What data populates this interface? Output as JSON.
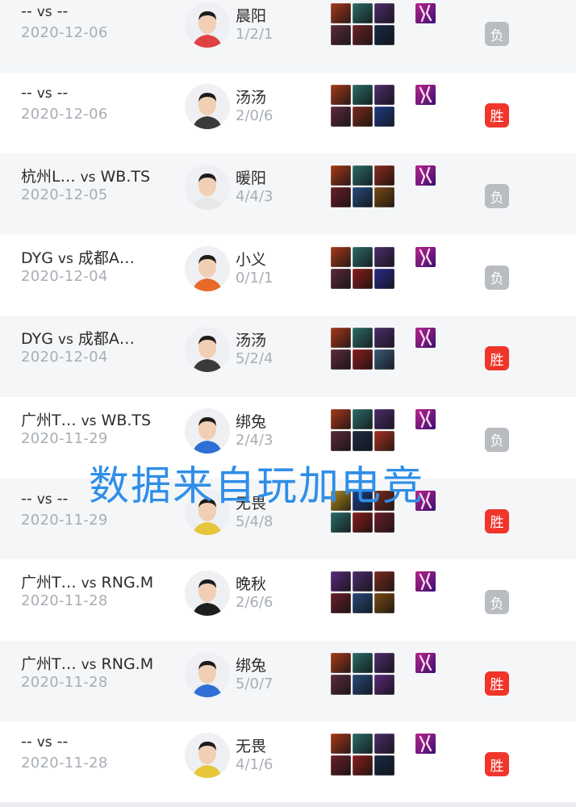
{
  "colors": {
    "win_badge": "#f0352b",
    "loss_badge": "#b9bcc1",
    "watermark": "#2f8ee8",
    "date_text": "#a8aeb5"
  },
  "matches": [
    {
      "team1": "--",
      "vs": "vs",
      "team2": "--",
      "date": "2020-12-06",
      "player": "晨阳",
      "kda": "1/2/1",
      "result": "负",
      "outcome": "loss",
      "jersey": "#e04141",
      "items": [
        "#a63a1c",
        "#2c6b6a",
        "#4d2d6b",
        "#5d2a3c",
        "#6b2424",
        "#172a46"
      ]
    },
    {
      "team1": "--",
      "vs": "vs",
      "team2": "--",
      "date": "2020-12-06",
      "player": "汤汤",
      "kda": "2/0/6",
      "result": "胜",
      "outcome": "win",
      "jersey": "#3a3a3a",
      "items": [
        "#a63a1c",
        "#2c6b6a",
        "#4d2d6b",
        "#5d2a3c",
        "#7a2b1f",
        "#1f3d86"
      ]
    },
    {
      "team1": "杭州L…",
      "vs": "vs",
      "team2": "WB.TS",
      "date": "2020-12-05",
      "player": "暖阳",
      "kda": "4/4/3",
      "result": "负",
      "outcome": "loss",
      "jersey": "#e8e8e8",
      "items": [
        "#a63a1c",
        "#2c6b6a",
        "#8a2a1d",
        "#6a1f2a",
        "#274a7a",
        "#7a4a14"
      ]
    },
    {
      "team1": "DYG",
      "vs": "vs",
      "team2": "成都A…",
      "date": "2020-12-04",
      "player": "小义",
      "kda": "0/1/1",
      "result": "负",
      "outcome": "loss",
      "jersey": "#e86a2a",
      "items": [
        "#a63a1c",
        "#2c6b6a",
        "#4d2d6b",
        "#5d2a3c",
        "#8a1d1d",
        "#2b2b8a"
      ]
    },
    {
      "team1": "DYG",
      "vs": "vs",
      "team2": "成都A…",
      "date": "2020-12-04",
      "player": "汤汤",
      "kda": "5/2/4",
      "result": "胜",
      "outcome": "win",
      "jersey": "#3a3a3a",
      "items": [
        "#a63a1c",
        "#2c6b6a",
        "#4d2d6b",
        "#5d2a3c",
        "#8a1d1d",
        "#3a5a7a"
      ]
    },
    {
      "team1": "广州T…",
      "vs": "vs",
      "team2": "WB.TS",
      "date": "2020-11-29",
      "player": "绑兔",
      "kda": "2/4/3",
      "result": "负",
      "outcome": "loss",
      "jersey": "#2f6fd6",
      "items": [
        "#a63a1c",
        "#2c6b6a",
        "#4d2d6b",
        "#5d2a3c",
        "#1f2a46",
        "#a83320"
      ]
    },
    {
      "team1": "--",
      "vs": "vs",
      "team2": "--",
      "date": "2020-11-29",
      "player": "无畏",
      "kda": "5/4/8",
      "result": "胜",
      "outcome": "win",
      "jersey": "#e6c63a",
      "items": [
        "#b08a1c",
        "#1f3d86",
        "#7a2b1f",
        "#2c6b6a",
        "#8a1d1d",
        "#6a1f2a"
      ]
    },
    {
      "team1": "广州T…",
      "vs": "vs",
      "team2": "RNG.M",
      "date": "2020-11-28",
      "player": "晚秋",
      "kda": "2/6/6",
      "result": "负",
      "outcome": "loss",
      "jersey": "#1e1e1e",
      "items": [
        "#5a2a7a",
        "#4d2d6b",
        "#7a2b1f",
        "#6a1f2a",
        "#274a7a",
        "#7a4a14"
      ]
    },
    {
      "team1": "广州T…",
      "vs": "vs",
      "team2": "RNG.M",
      "date": "2020-11-28",
      "player": "绑兔",
      "kda": "5/0/7",
      "result": "胜",
      "outcome": "win",
      "jersey": "#2f6fd6",
      "items": [
        "#a63a1c",
        "#2c6b6a",
        "#4d2d6b",
        "#5d2a3c",
        "#274a7a",
        "#5a2a7a"
      ]
    },
    {
      "team1": "--",
      "vs": "vs",
      "team2": "--",
      "date": "2020-11-28",
      "player": "无畏",
      "kda": "4/1/6",
      "result": "胜",
      "outcome": "win",
      "jersey": "#e6c63a",
      "items": [
        "#a63a1c",
        "#2c6b6a",
        "#4d2d6b",
        "#6a1f2a",
        "#8a1d1d",
        "#172a46"
      ]
    }
  ],
  "watermark": "数据来自玩加电竞"
}
